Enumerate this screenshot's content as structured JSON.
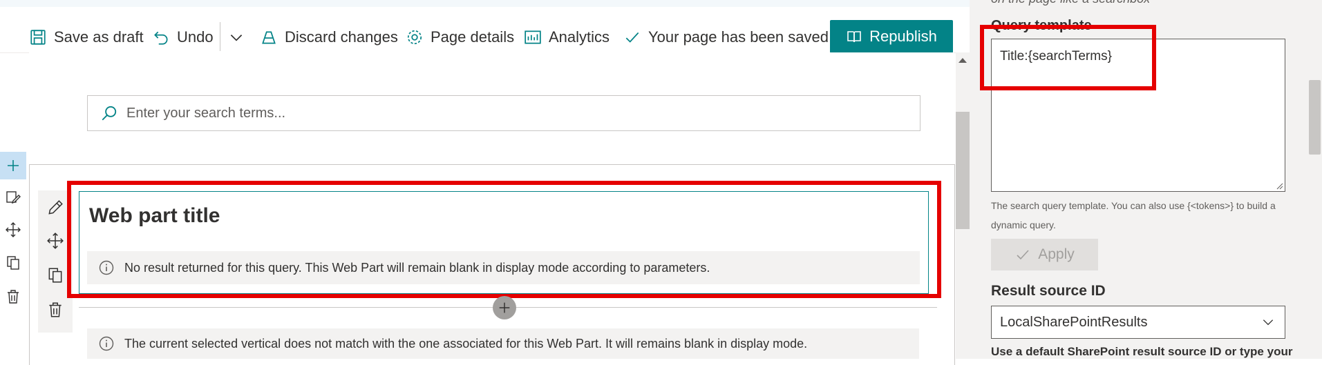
{
  "toolbar": {
    "save_draft": "Save as draft",
    "undo": "Undo",
    "discard": "Discard changes",
    "page_details": "Page details",
    "analytics": "Analytics",
    "saved_status": "Your page has been saved",
    "republish": "Republish"
  },
  "search": {
    "placeholder": "Enter your search terms..."
  },
  "webpart": {
    "title": "Web part title",
    "no_result_message": "No result returned for this query. This Web Part will remain blank in display mode according to parameters."
  },
  "vertical_message": "The current selected vertical does not match with the one associated for this Web Part. It will remains blank in display mode.",
  "property_pane": {
    "cut_text": "on the page like a searchbox",
    "query_template_label": "Query template",
    "query_template_value": "Title:{searchTerms}",
    "query_template_help": "The search query template. You can also use {<tokens>} to build a dynamic query.",
    "apply": "Apply",
    "result_source_label": "Result source ID",
    "result_source_value": "LocalSharePointResults",
    "result_source_help": "Use a default SharePoint result source ID or type your"
  },
  "colors": {
    "accent": "#038387",
    "highlight": "#e50000"
  }
}
